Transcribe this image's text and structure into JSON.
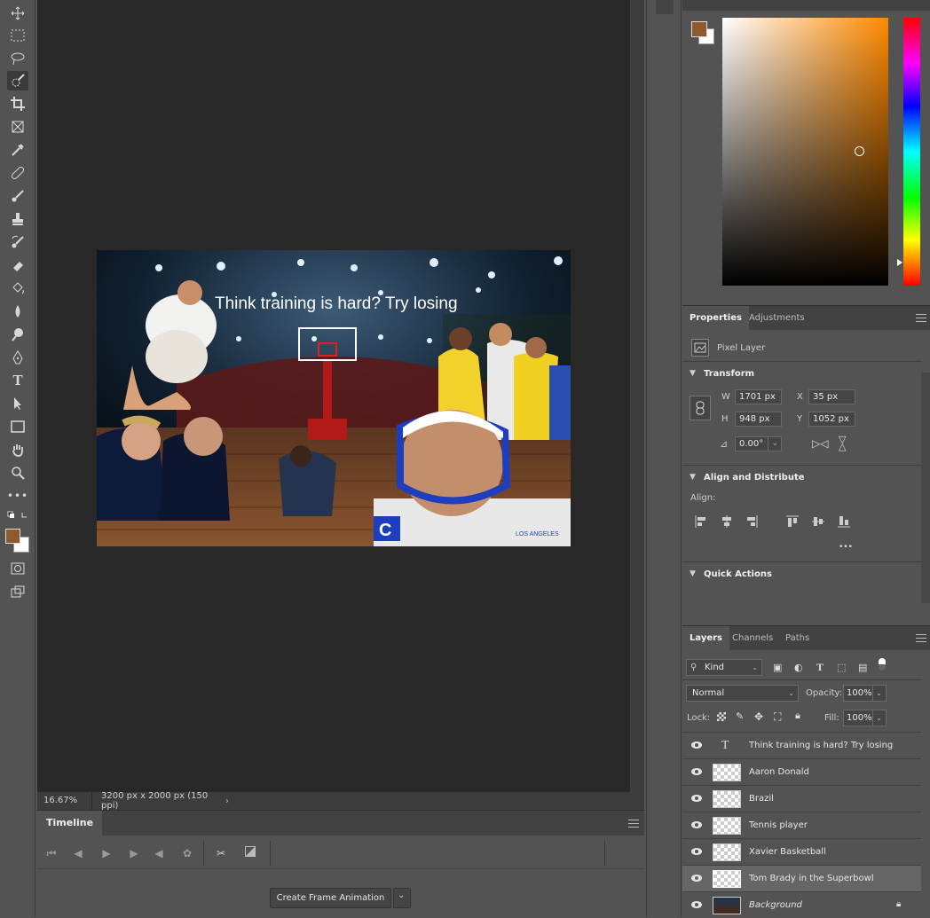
{
  "canvas": {
    "headline": "Think training is hard? Try losing",
    "zoom": "16.67%",
    "doc_size": "3200 px x 2000 px (150 ppi)"
  },
  "timeline": {
    "tab": "Timeline",
    "create_button": "Create Frame Animation"
  },
  "colors": {
    "foreground": "#8d5a2e",
    "background": "#ffffff"
  },
  "properties": {
    "tabs": [
      "Properties",
      "Adjustments"
    ],
    "layer_type": "Pixel Layer",
    "transform_title": "Transform",
    "w_label": "W",
    "w_value": "1701 px",
    "h_label": "H",
    "h_value": "948 px",
    "x_label": "X",
    "x_value": "35 px",
    "y_label": "Y",
    "y_value": "1052 px",
    "angle": "0.00°",
    "align_title": "Align and Distribute",
    "align_label": "Align:",
    "more": "•••",
    "quick_actions_title": "Quick Actions"
  },
  "layers_panel": {
    "tabs": [
      "Layers",
      "Channels",
      "Paths"
    ],
    "filter_kind": "Kind",
    "blend_mode": "Normal",
    "opacity_label": "Opacity:",
    "opacity_value": "100%",
    "lock_label": "Lock:",
    "fill_label": "Fill:",
    "fill_value": "100%",
    "layers": [
      {
        "name": "Think training is hard? Try losing",
        "type": "text",
        "selected": false
      },
      {
        "name": "Aaron Donald",
        "type": "pixel",
        "selected": false
      },
      {
        "name": "Brazil",
        "type": "pixel",
        "selected": false
      },
      {
        "name": "Tennis player",
        "type": "pixel",
        "selected": false
      },
      {
        "name": "Xavier Basketball",
        "type": "pixel",
        "selected": false
      },
      {
        "name": "Tom Brady in the Superbowl",
        "type": "pixel",
        "selected": true
      },
      {
        "name": "Background",
        "type": "background",
        "selected": false,
        "locked": true
      }
    ]
  }
}
